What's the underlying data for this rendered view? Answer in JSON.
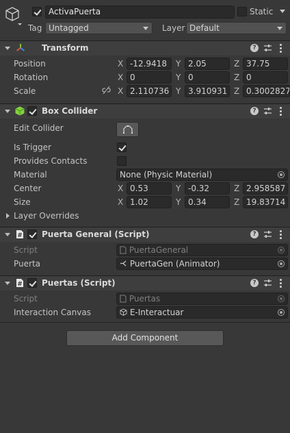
{
  "object": {
    "name": "ActivaPuerta",
    "static_label": "Static",
    "tag_label": "Tag",
    "tag_value": "Untagged",
    "layer_label": "Layer",
    "layer_value": "Default"
  },
  "transform": {
    "title": "Transform",
    "rows": [
      {
        "label": "Position",
        "x": "-12.9418",
        "y": "2.05",
        "z": "37.75"
      },
      {
        "label": "Rotation",
        "x": "0",
        "y": "0",
        "z": "0"
      },
      {
        "label": "Scale",
        "x": "2.110736",
        "y": "3.910931",
        "z": "0.3002827"
      }
    ]
  },
  "box_collider": {
    "title": "Box Collider",
    "edit_collider_label": "Edit Collider",
    "is_trigger_label": "Is Trigger",
    "provides_contacts_label": "Provides Contacts",
    "material_label": "Material",
    "material_value": "None (Physic Material)",
    "center": {
      "label": "Center",
      "x": "0.53",
      "y": "-0.32",
      "z": "2.958587"
    },
    "size": {
      "label": "Size",
      "x": "1.02",
      "y": "0.34",
      "z": "19.83714"
    },
    "layer_overrides_label": "Layer Overrides"
  },
  "puerta_general": {
    "title": "Puerta General (Script)",
    "script_label": "Script",
    "script_value": "PuertaGeneral",
    "puerta_label": "Puerta",
    "puerta_value": "PuertaGen (Animator)"
  },
  "puertas": {
    "title": "Puertas (Script)",
    "script_label": "Script",
    "script_value": "Puertas",
    "canvas_label": "Interaction Canvas",
    "canvas_value": "E-Interactuar"
  },
  "axis_labels": {
    "x": "X",
    "y": "Y",
    "z": "Z"
  },
  "add_component_label": "Add Component",
  "help_glyph": "?"
}
